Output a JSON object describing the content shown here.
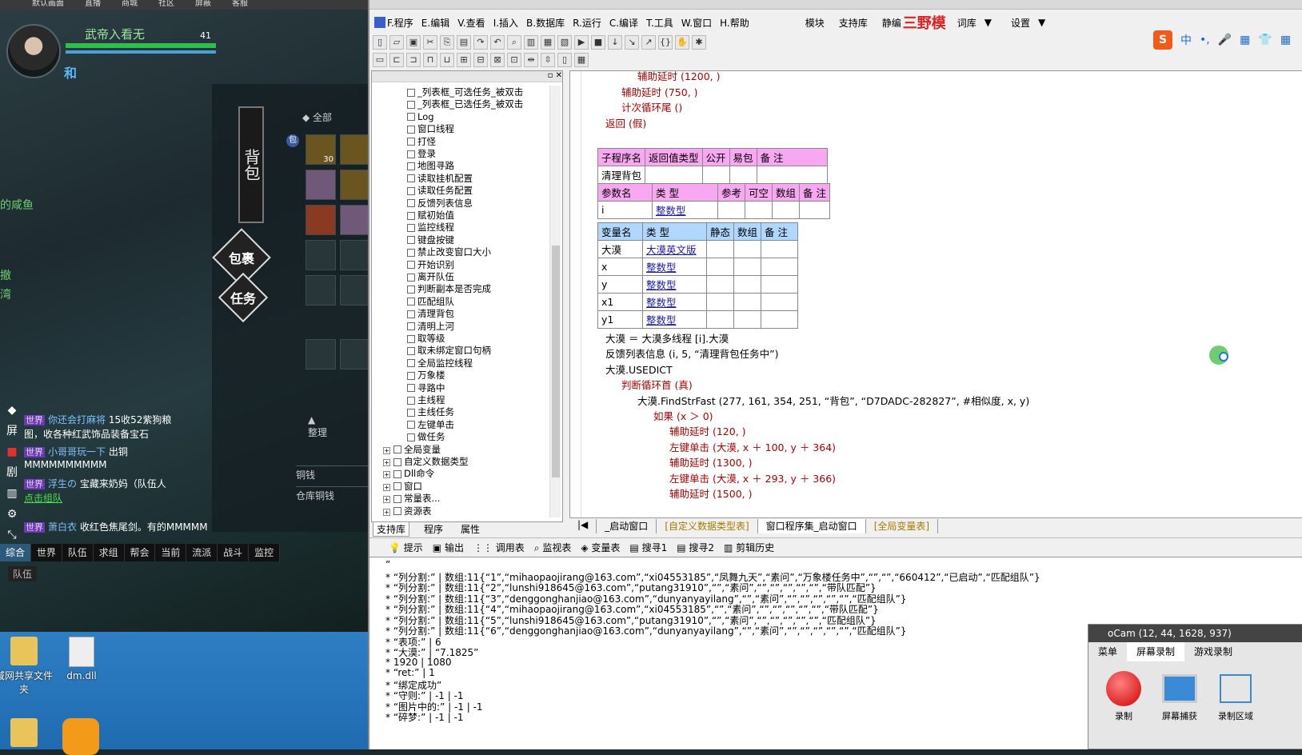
{
  "game": {
    "top_labels": [
      "默认画面",
      "直播",
      "商城",
      "社区",
      "屏蔽",
      "客服"
    ],
    "player_name": "武帝入看无",
    "player_level": "41",
    "player_tag": "和",
    "bag_title": "背包",
    "filter_all": "全部",
    "bag_tab": "包",
    "slot_count": "30",
    "nav_bag": "包裹",
    "nav_task": "任务",
    "sort_label": "整理",
    "money1": "铜钱",
    "money2": "仓库铜钱",
    "world_text1": "的咸鱼",
    "world_text2": "撤",
    "world_text3": "湾",
    "left_icons": [
      "屏",
      "剧"
    ],
    "chat": [
      {
        "channel": "世界",
        "name": "你还会打麻将",
        "text": "15收52紫狗粮"
      },
      {
        "channel": "",
        "name": "",
        "text": "图，收各种红武饰品装备宝石"
      },
      {
        "channel": "世界",
        "name": "小哥哥玩一下",
        "text": "出铜"
      },
      {
        "channel": "",
        "name": "",
        "text": "MMMMMMMMMM"
      },
      {
        "channel": "世界",
        "name": "浮生の",
        "text": "宝藏来奶妈（队伍人"
      },
      {
        "channel": "",
        "name": "",
        "text": "点击组队"
      },
      {
        "channel": "世界",
        "name": "萧白衣",
        "text": "收红色焦尾剑。有的MMMMM"
      }
    ],
    "chat_tabs": [
      "综合",
      "世界",
      "队伍",
      "求组",
      "帮会",
      "当前",
      "流派",
      "战斗",
      "监控"
    ],
    "team_label": "队伍"
  },
  "desktop": {
    "icons": [
      "域网共享文件夹",
      "dm.dll"
    ]
  },
  "ide": {
    "menu": [
      "F.程序",
      "E.编辑",
      "V.查看",
      "I.插入",
      "B.数据库",
      "R.运行",
      "C.编译",
      "T.工具",
      "W.窗口",
      "H.帮助"
    ],
    "menu_right": [
      "模块",
      "支持库",
      "静编",
      "词库",
      "设置"
    ],
    "logo_text": "三野模",
    "ime": [
      "S",
      "中",
      "•,",
      "🎤",
      "▦",
      "👕",
      "▦"
    ],
    "tree_items": [
      "_列表框_可选任务_被双击",
      "_列表框_已选任务_被双击",
      "Log",
      "窗口线程",
      "打怪",
      "登录",
      "地图寻路",
      "读取挂机配置",
      "读取任务配置",
      "反馈列表信息",
      "赋初始值",
      "监控线程",
      "键盘按键",
      "禁止改变窗口大小",
      "开始识别",
      "离开队伍",
      "判断副本是否完成",
      "匹配组队",
      "清理背包",
      "清明上河",
      "取等级",
      "取未绑定窗口句柄",
      "全局监控线程",
      "万象楼",
      "寻路中",
      "主线程",
      "主线任务",
      "左键单击",
      "做任务"
    ],
    "tree_roots": [
      "全局变量",
      "自定义数据类型",
      "Dll命令",
      "窗口",
      "常量表...",
      "资源表"
    ],
    "left_tabs": [
      "支持库",
      "程序",
      "属性"
    ],
    "code_top": [
      {
        "text": "辅助延时 (1200, )",
        "indent": 3
      },
      {
        "text": "辅助延时 (750, )",
        "indent": 2
      },
      {
        "text": "计次循环尾 ()",
        "indent": 2
      },
      {
        "text": "返回 (假)",
        "indent": 1
      }
    ],
    "sub_table": {
      "headers": [
        "子程序名",
        "返回值类型",
        "公开",
        "易包",
        "备 注"
      ],
      "name": "清理背包",
      "param_headers": [
        "参数名",
        "类 型",
        "参考",
        "可空",
        "数组",
        "备 注"
      ],
      "param": {
        "name": "i",
        "type": "整数型"
      }
    },
    "var_table": {
      "headers": [
        "变量名",
        "类 型",
        "静态",
        "数组",
        "备 注"
      ],
      "rows": [
        {
          "name": "大漠",
          "type": "大漠英文版"
        },
        {
          "name": "x",
          "type": "整数型"
        },
        {
          "name": "y",
          "type": "整数型"
        },
        {
          "name": "x1",
          "type": "整数型"
        },
        {
          "name": "y1",
          "type": "整数型"
        }
      ]
    },
    "code_bottom": [
      {
        "text": "大漠 ＝ 大漠多线程 [i].大漠",
        "indent": 1
      },
      {
        "text": "反馈列表信息 (i, 5, “清理背包任务中”)",
        "indent": 1
      },
      {
        "text": "大漠.USEDICT",
        "indent": 1
      },
      {
        "text": "判断循环首 (真)",
        "indent": 2
      },
      {
        "text": "大漠.FindStrFast (277, 161, 354, 251, “背包”, “D7DADC-282827”, #相似度, x, y)",
        "indent": 3
      },
      {
        "text": "如果 (x ＞ 0)",
        "indent": 4
      },
      {
        "text": "辅助延时 (120, )",
        "indent": 5
      },
      {
        "text": "左键单击 (大漠, x ＋ 100, y ＋ 364)",
        "indent": 5
      },
      {
        "text": "辅助延时 (1300, )",
        "indent": 5
      },
      {
        "text": "左键单击 (大漠, x ＋ 293, y ＋ 366)",
        "indent": 5
      },
      {
        "text": "辅助延时 (1500, )",
        "indent": 5
      }
    ],
    "bottom_tabs": [
      "_启动窗口",
      "[自定义数据类型表]",
      "窗口程序集_启动窗口",
      "[全局变量表]"
    ],
    "output_tabs": [
      "提示",
      "输出",
      "调用表",
      "监视表",
      "变量表",
      "搜寻1",
      "搜寻2",
      "剪辑历史"
    ],
    "output_lines": [
      "”",
      "* “列分割:” | 数组:11{“1”,“mihaopaojirang@163.com”,“xi04553185”,“凤舞九天”,“素问”,“万象楼任务中”,“”,“”,“660412”,“已启动”,“匹配组队”}",
      "* “列分割:” | 数组:11{“2”,“lunshi918645@163.com”,“putang31910”,“”,“素问”,“”,“”,“”,“”,“”,“带队匹配”}",
      "* “列分割:” | 数组:11{“3”,“denggonghanjiao@163.com”,“dunyanyayilang”,“”,“素问”,“”,“”,“”,“”,“”,“匹配组队”}",
      "* “列分割:” | 数组:11{“4”,“mihaopaojirang@163.com”,“xi04553185”,“”,“素问”,“”,“”,“”,“”,“”,“带队匹配”}",
      "* “列分割:” | 数组:11{“5”,“lunshi918645@163.com”,“putang31910”,“”,“素问”,“”,“”,“”,“”,“”,“匹配组队”}",
      "* “列分割:” | 数组:11{“6”,“denggonghanjiao@163.com”,“dunyanyayilang”,“”,“素问”,“”,“”,“”,“”,“”,“匹配组队”}",
      "* “表项:” | 6",
      "* “大漠:” | “7.1825”",
      "* 1920 | 1080",
      "* “ret:” | 1",
      "* “绑定成功”",
      "* “守则:” | -1 | -1",
      "* “图片中的:” | -1 | -1",
      "* “碎梦:” | -1 | -1"
    ]
  },
  "ocam": {
    "title": "oCam (12, 44, 1628, 937)",
    "tabs": [
      "菜单",
      "屏幕录制",
      "游戏录制"
    ],
    "buttons": [
      "录制",
      "屏幕捕获",
      "录制区域"
    ]
  }
}
